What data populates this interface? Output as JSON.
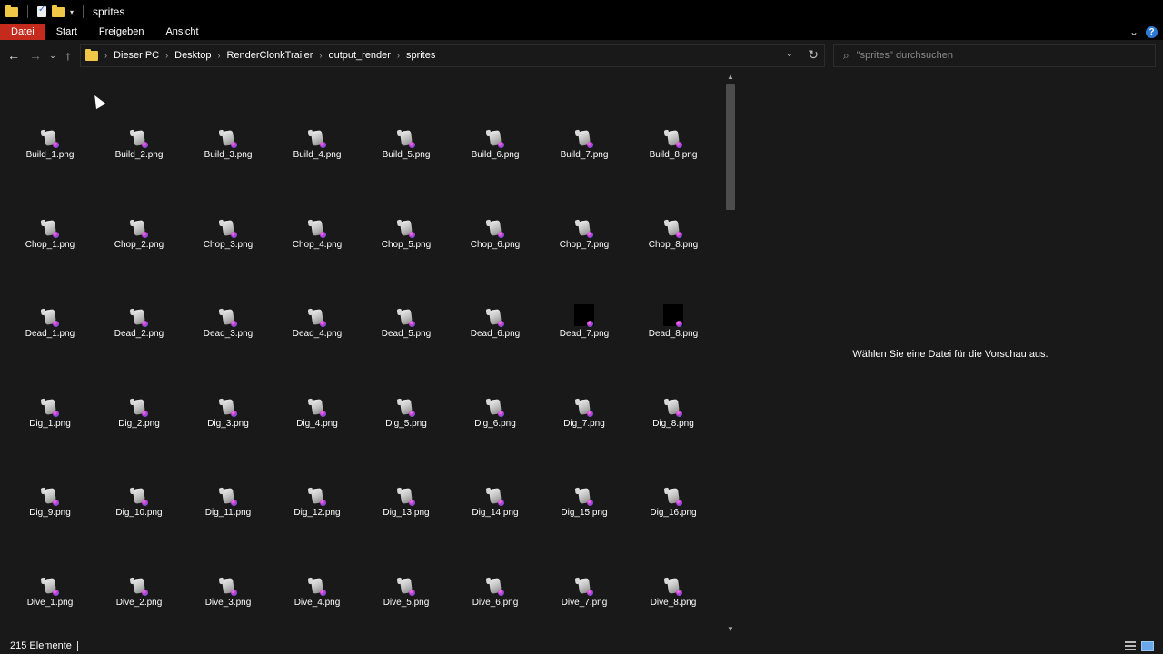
{
  "window": {
    "title": "sprites"
  },
  "ribbon": {
    "tabs": [
      "Datei",
      "Start",
      "Freigeben",
      "Ansicht"
    ],
    "help_label": "?"
  },
  "breadcrumb": [
    "Dieser PC",
    "Desktop",
    "RenderClonkTrailer",
    "output_render",
    "sprites"
  ],
  "search": {
    "placeholder": "\"sprites\" durchsuchen"
  },
  "files": [
    {
      "name": "Build_1.png"
    },
    {
      "name": "Build_2.png"
    },
    {
      "name": "Build_3.png"
    },
    {
      "name": "Build_4.png"
    },
    {
      "name": "Build_5.png"
    },
    {
      "name": "Build_6.png"
    },
    {
      "name": "Build_7.png"
    },
    {
      "name": "Build_8.png"
    },
    {
      "name": "Chop_1.png"
    },
    {
      "name": "Chop_2.png"
    },
    {
      "name": "Chop_3.png"
    },
    {
      "name": "Chop_4.png"
    },
    {
      "name": "Chop_5.png"
    },
    {
      "name": "Chop_6.png"
    },
    {
      "name": "Chop_7.png"
    },
    {
      "name": "Chop_8.png"
    },
    {
      "name": "Dead_1.png"
    },
    {
      "name": "Dead_2.png"
    },
    {
      "name": "Dead_3.png"
    },
    {
      "name": "Dead_4.png"
    },
    {
      "name": "Dead_5.png"
    },
    {
      "name": "Dead_6.png"
    },
    {
      "name": "Dead_7.png",
      "thumb": "black"
    },
    {
      "name": "Dead_8.png",
      "thumb": "black"
    },
    {
      "name": "Dig_1.png"
    },
    {
      "name": "Dig_2.png"
    },
    {
      "name": "Dig_3.png"
    },
    {
      "name": "Dig_4.png"
    },
    {
      "name": "Dig_5.png"
    },
    {
      "name": "Dig_6.png"
    },
    {
      "name": "Dig_7.png"
    },
    {
      "name": "Dig_8.png"
    },
    {
      "name": "Dig_9.png"
    },
    {
      "name": "Dig_10.png"
    },
    {
      "name": "Dig_11.png"
    },
    {
      "name": "Dig_12.png"
    },
    {
      "name": "Dig_13.png"
    },
    {
      "name": "Dig_14.png"
    },
    {
      "name": "Dig_15.png"
    },
    {
      "name": "Dig_16.png"
    },
    {
      "name": "Dive_1.png"
    },
    {
      "name": "Dive_2.png"
    },
    {
      "name": "Dive_3.png"
    },
    {
      "name": "Dive_4.png"
    },
    {
      "name": "Dive_5.png"
    },
    {
      "name": "Dive_6.png"
    },
    {
      "name": "Dive_7.png"
    },
    {
      "name": "Dive_8.png"
    }
  ],
  "preview": {
    "message": "Wählen Sie eine Datei für die Vorschau aus."
  },
  "status": {
    "count": "215 Elemente"
  },
  "colors": {
    "background": "#191919",
    "active_tab": "#c42b1c",
    "folder": "#f1c748",
    "help": "#2d7ad6"
  },
  "icons": {
    "back": "arrow-left-icon",
    "forward": "arrow-right-icon",
    "recent": "chevron-down-icon",
    "up": "arrow-up-icon",
    "refresh": "refresh-icon",
    "search": "search-icon"
  }
}
